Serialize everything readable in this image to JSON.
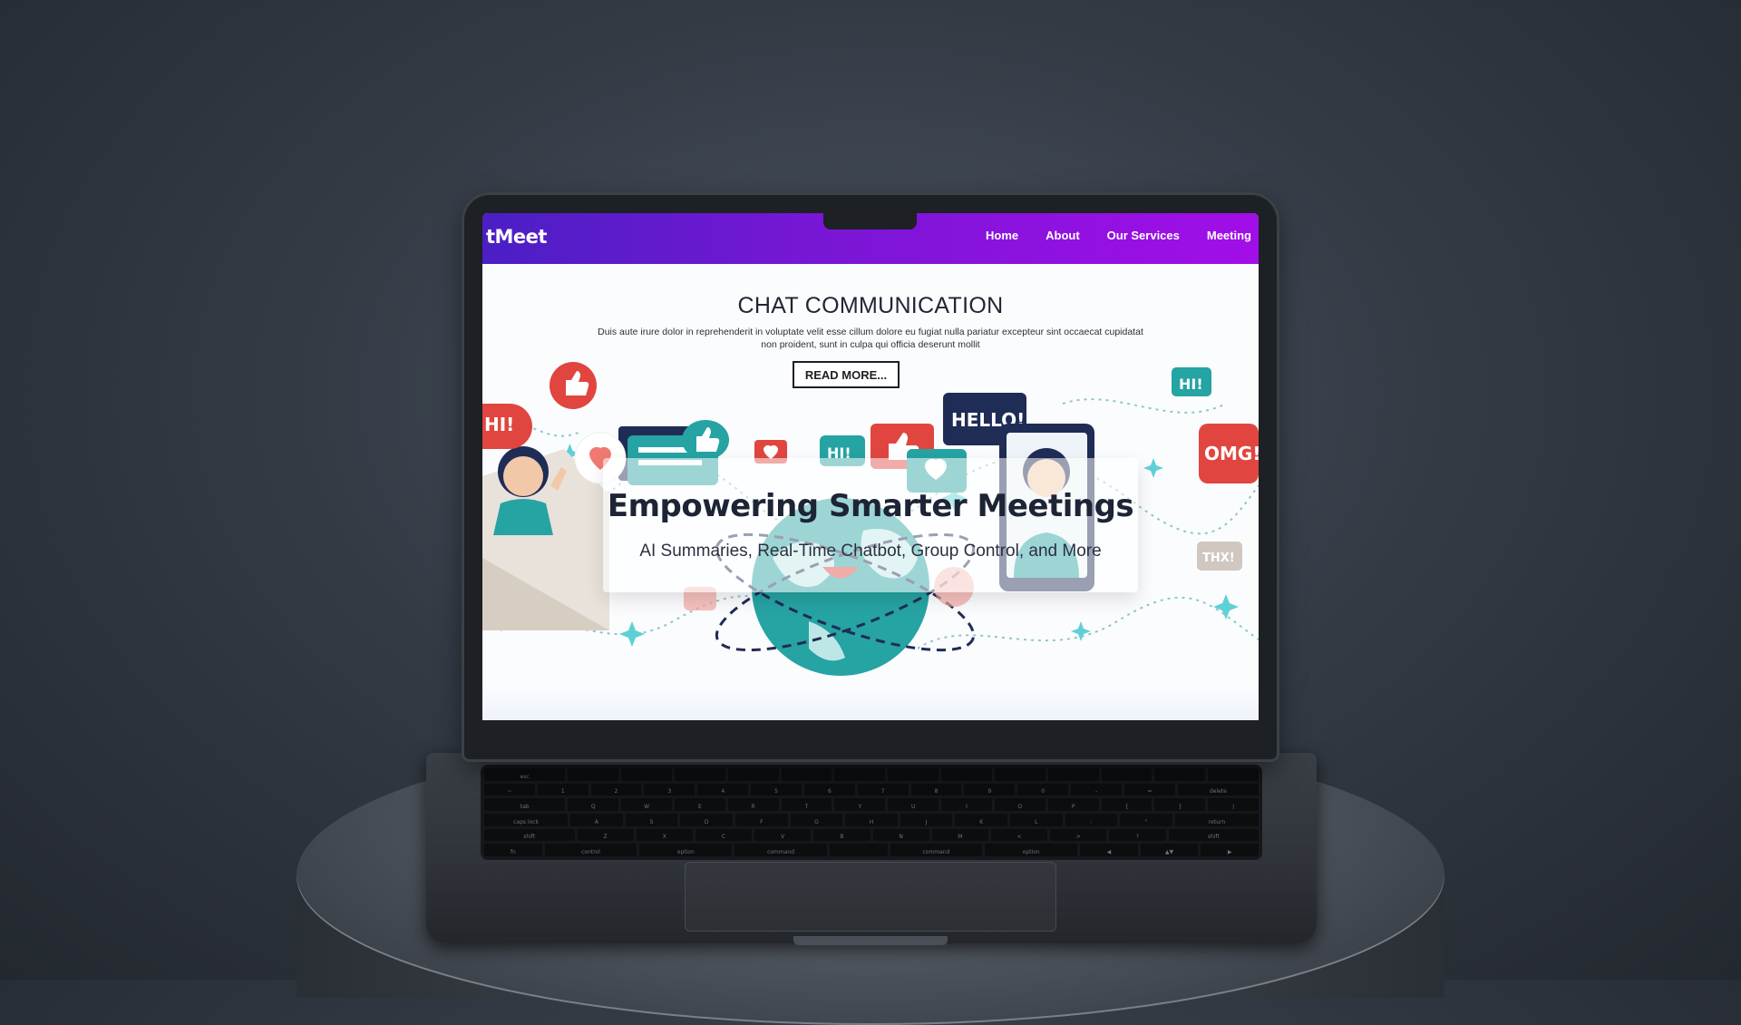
{
  "site": {
    "brand": "tMeet",
    "nav": [
      "Home",
      "About",
      "Our Services",
      "Meeting"
    ]
  },
  "hero": {
    "title": "CHAT COMMUNICATION",
    "description": "Duis aute irure dolor in reprehenderit in voluptate velit esse cillum dolore eu fugiat nulla pariatur excepteur sint occaecat cupidatat non proident, sunt in culpa qui officia deserunt mollit",
    "button": "READ MORE..."
  },
  "overlay": {
    "title": "Empowering Smarter Meetings",
    "subtitle": "AI Summaries, Real-Time Chatbot, Group Control, and More"
  },
  "illustration": {
    "bubbles": [
      "HELLO!",
      "OMG!",
      "HI!",
      "HI!",
      "HI!",
      "THX!"
    ]
  },
  "keyboard": {
    "rows": [
      [
        "esc",
        "",
        "",
        "",
        "",
        "",
        "",
        "",
        "",
        "",
        "",
        "",
        "",
        ""
      ],
      [
        "~",
        "1",
        "2",
        "3",
        "4",
        "5",
        "6",
        "7",
        "8",
        "9",
        "0",
        "-",
        "=",
        "delete"
      ],
      [
        "tab",
        "Q",
        "W",
        "E",
        "R",
        "T",
        "Y",
        "U",
        "I",
        "O",
        "P",
        "{",
        "}",
        "|"
      ],
      [
        "caps lock",
        "A",
        "S",
        "D",
        "F",
        "G",
        "H",
        "J",
        "K",
        "L",
        ":",
        "\"",
        "return"
      ],
      [
        "shift",
        "Z",
        "X",
        "C",
        "V",
        "B",
        "N",
        "M",
        "<",
        ">",
        "?",
        "shift"
      ],
      [
        "fn",
        "control",
        "option",
        "command",
        "",
        "command",
        "option",
        "◀",
        "▲▼",
        "▶"
      ]
    ]
  },
  "colors": {
    "nav_gradient_start": "#4a1fc4",
    "nav_gradient_end": "#a20ee8",
    "teal": "#1f9a9a",
    "red": "#e0463f",
    "navy": "#1f2c56"
  }
}
